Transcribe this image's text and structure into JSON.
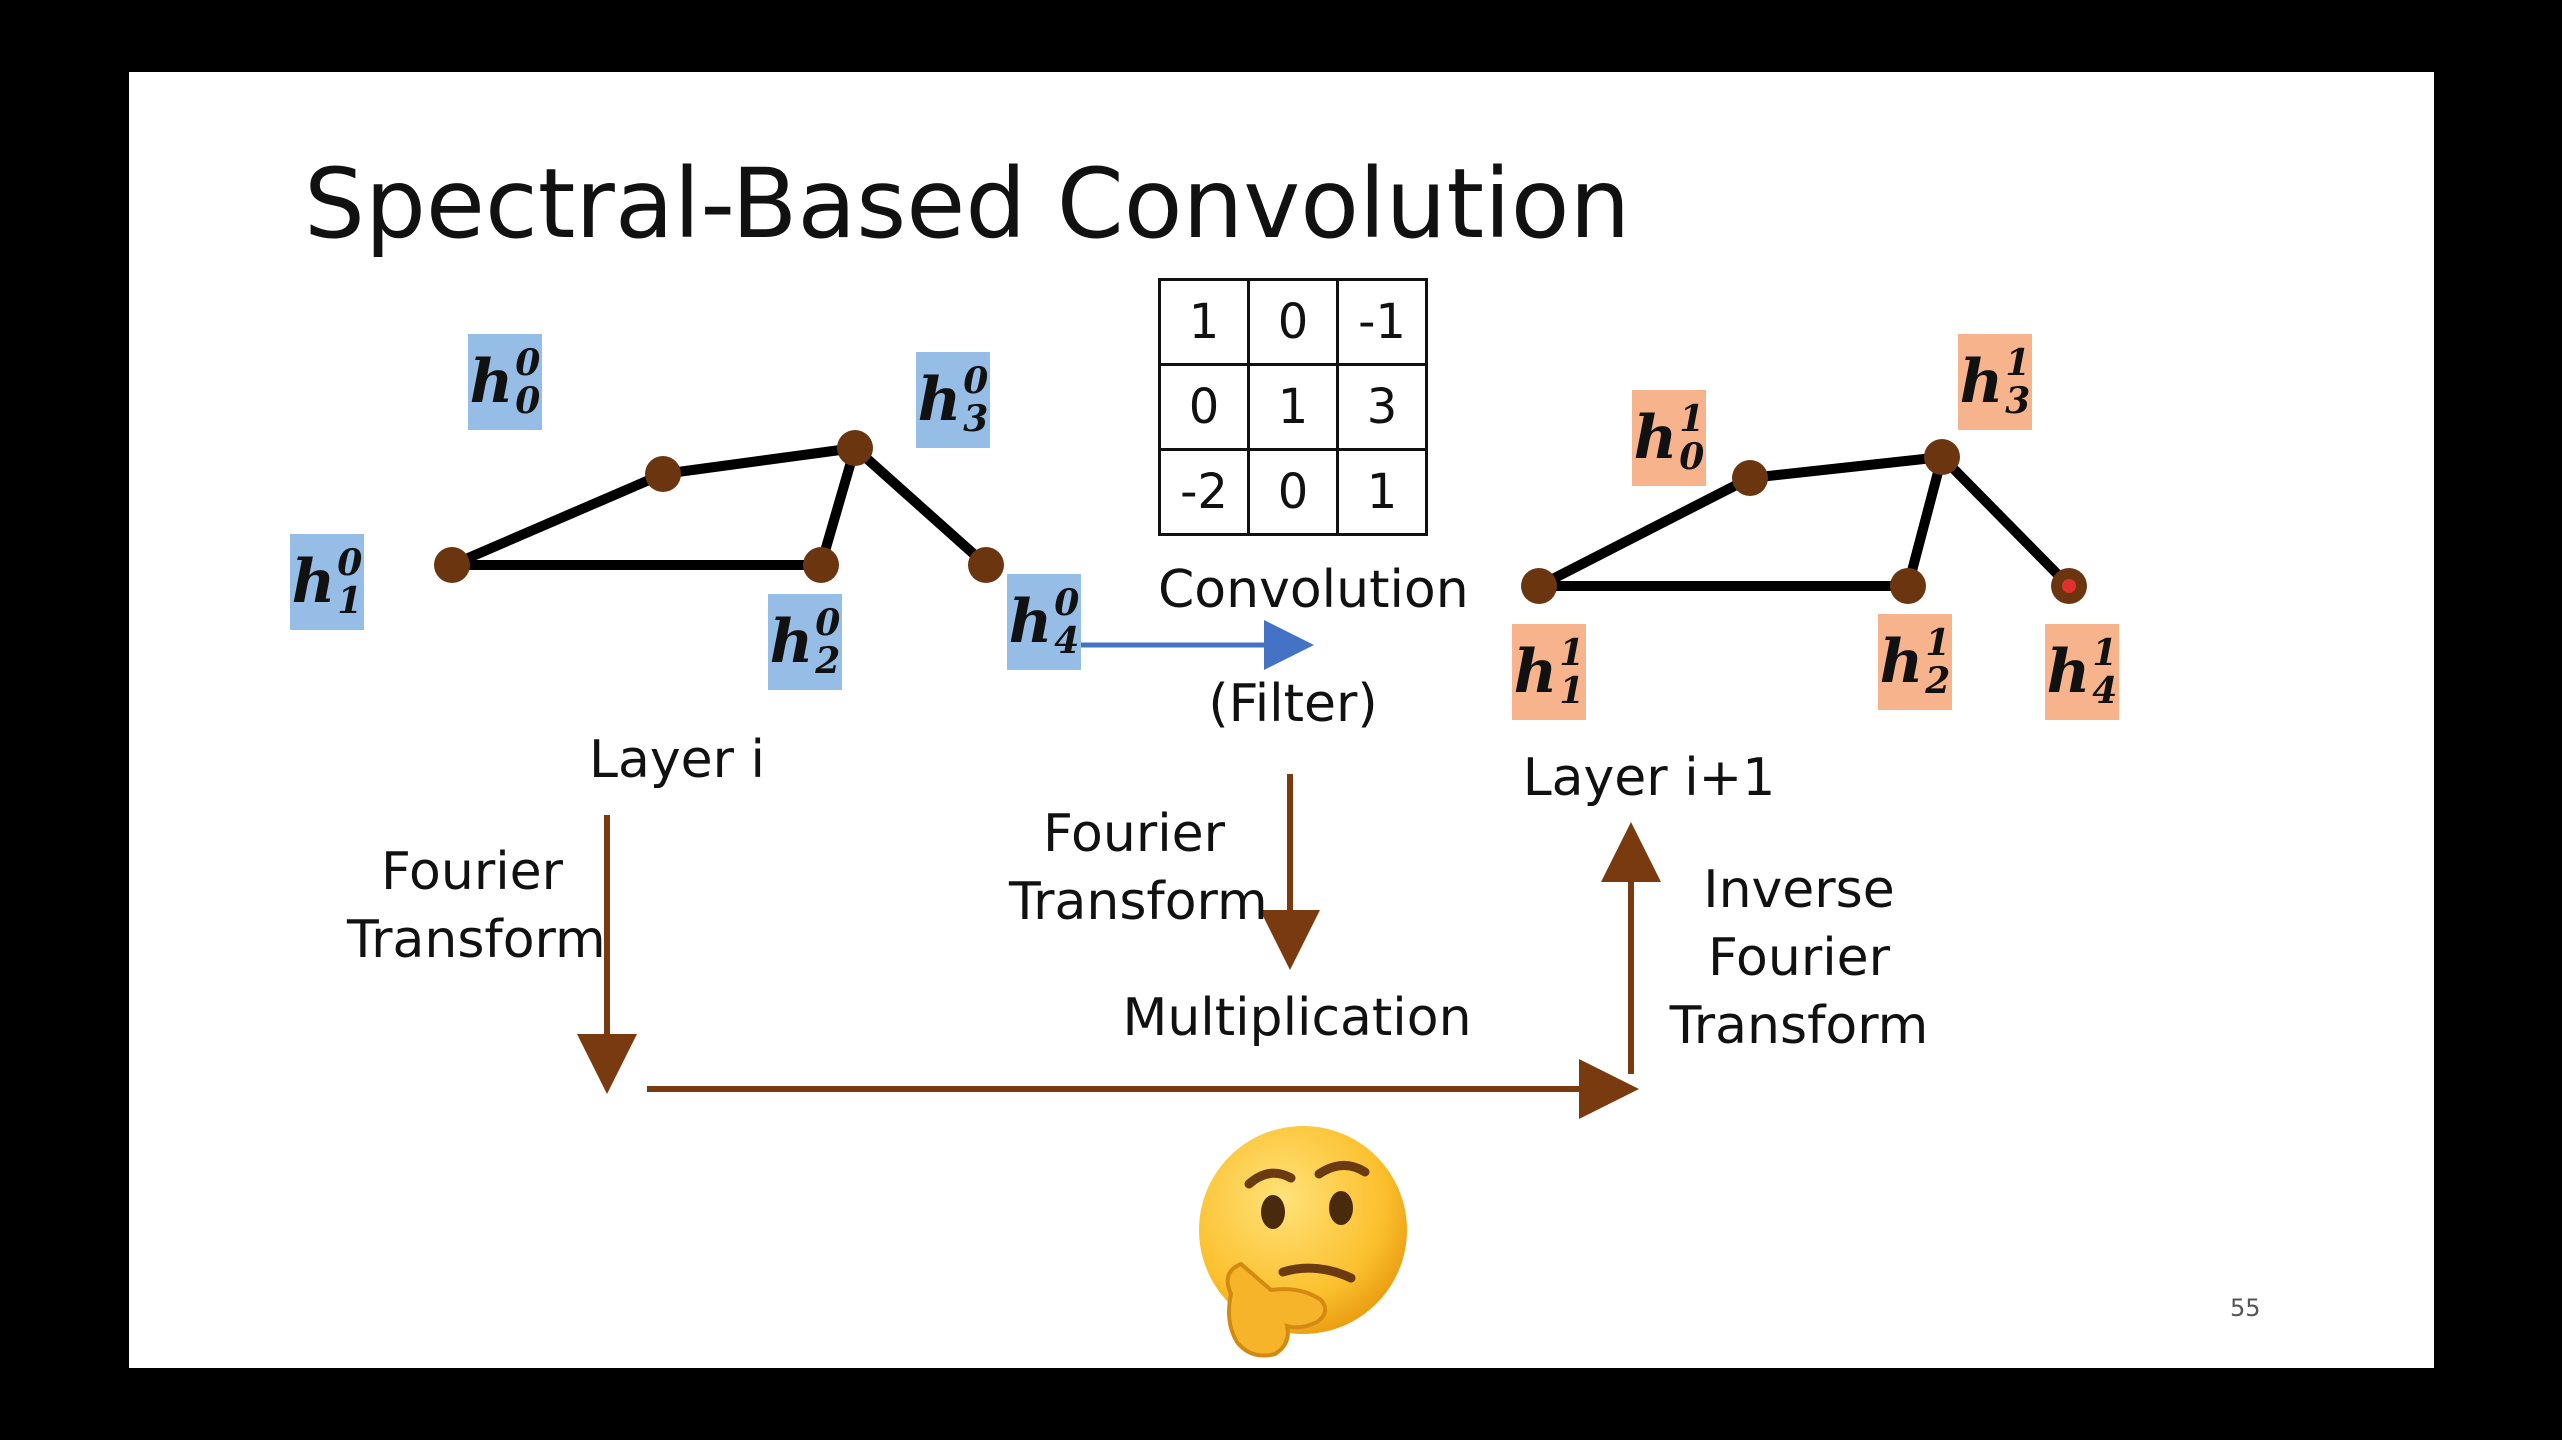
{
  "title": "Spectral-Based Convolution",
  "page_number": "55",
  "layer_in": {
    "caption": "Layer i",
    "nodes": [
      {
        "base": "h",
        "sup": "0",
        "sub": "0"
      },
      {
        "base": "h",
        "sup": "0",
        "sub": "1"
      },
      {
        "base": "h",
        "sup": "0",
        "sub": "2"
      },
      {
        "base": "h",
        "sup": "0",
        "sub": "3"
      },
      {
        "base": "h",
        "sup": "0",
        "sub": "4"
      }
    ]
  },
  "layer_out": {
    "caption": "Layer i+1",
    "nodes": [
      {
        "base": "h",
        "sup": "1",
        "sub": "0"
      },
      {
        "base": "h",
        "sup": "1",
        "sub": "1"
      },
      {
        "base": "h",
        "sup": "1",
        "sub": "2"
      },
      {
        "base": "h",
        "sup": "1",
        "sub": "3"
      },
      {
        "base": "h",
        "sup": "1",
        "sub": "4"
      }
    ]
  },
  "filter_matrix": [
    [
      "1",
      "0",
      "-1"
    ],
    [
      "0",
      "1",
      "3"
    ],
    [
      "-2",
      "0",
      "1"
    ]
  ],
  "labels": {
    "convolution": "Convolution",
    "filter": "(Filter)",
    "ft_left": [
      "Fourier",
      "Transform"
    ],
    "ft_mid": [
      "Fourier",
      "Transform"
    ],
    "multiplication": "Multiplication",
    "inverse_ft": [
      "Inverse",
      "Fourier",
      "Transform"
    ]
  },
  "colors": {
    "input_label_bg": "#95bde6",
    "output_label_bg": "#f7b48c",
    "node_fill": "#6b3510",
    "edge": "#000000",
    "transform_arrow": "#7a3a10",
    "convolution_arrow": "#4472c4"
  },
  "emoji": "thinking-face"
}
